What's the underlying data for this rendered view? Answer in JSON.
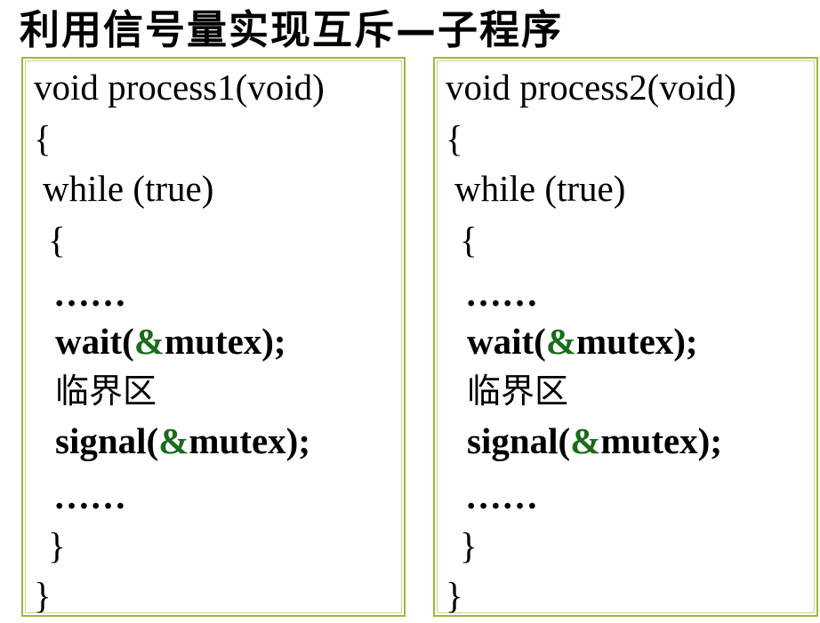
{
  "title": "利用信号量实现互斥—子程序",
  "colors": {
    "box_border": "#9bbb3a",
    "ampersand": "#1a6b1a"
  },
  "process1": {
    "signature": "void process1(void)",
    "open_brace": "{",
    "while": "while (true)",
    "loop_open": "{",
    "ellipsis_before": "……",
    "wait_prefix": "wait(",
    "wait_amp": "&",
    "wait_suffix": "mutex);",
    "critical_section": "临界区",
    "signal_prefix": "signal(",
    "signal_amp": "&",
    "signal_suffix": "mutex);",
    "ellipsis_after": "……",
    "loop_close": "}",
    "close_brace": "}"
  },
  "process2": {
    "signature": "void process2(void)",
    "open_brace": "{",
    "while": "while (true)",
    "loop_open": "{",
    "ellipsis_before": "……",
    "wait_prefix": "wait(",
    "wait_amp": "&",
    "wait_suffix": "mutex);",
    "critical_section": "临界区",
    "signal_prefix": "signal(",
    "signal_amp": "&",
    "signal_suffix": "mutex);",
    "ellipsis_after": "……",
    "loop_close": "}",
    "close_brace": "}"
  }
}
